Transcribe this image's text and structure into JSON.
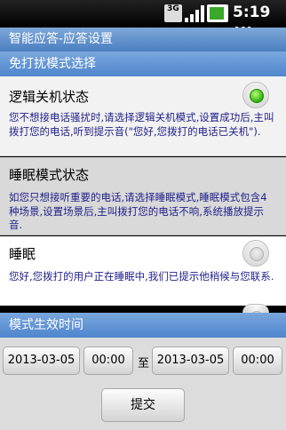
{
  "status_bar": {
    "network": "3G",
    "time": "5:19",
    "ampm": "AM"
  },
  "title": "智能应答-应答设置",
  "section_dnd": "免打扰模式选择",
  "modes": [
    {
      "title": "逻辑关机状态",
      "desc": "您不想接电话骚扰时,请选择逻辑关机模式,设置成功后,主叫拨打您的电话,听到提示音(\"您好,您拨打的电话已关机\").",
      "selected": true
    },
    {
      "title": "睡眠模式状态",
      "desc": "如您只想接听重要的电话,请选择睡眠模式,睡眠模式包含4种场景,设置场景后,主叫拨打您的电话不响,系统播放提示音.",
      "selected": false
    },
    {
      "title": "睡眠",
      "desc": "您好,您拨打的用户正在睡眠中,我们已提示他稍候与您联系.",
      "selected": false
    }
  ],
  "section_time": "模式生效时间",
  "time_range": {
    "start_date": "2013-03-05",
    "start_time": "00:00",
    "to_label": "至",
    "end_date": "2013-03-05",
    "end_time": "00:00"
  },
  "submit_label": "提交",
  "colors": {
    "header_blue": "#5a8fd0",
    "desc_text": "#1f1f8a",
    "radio_selected": "#2fb00b"
  }
}
